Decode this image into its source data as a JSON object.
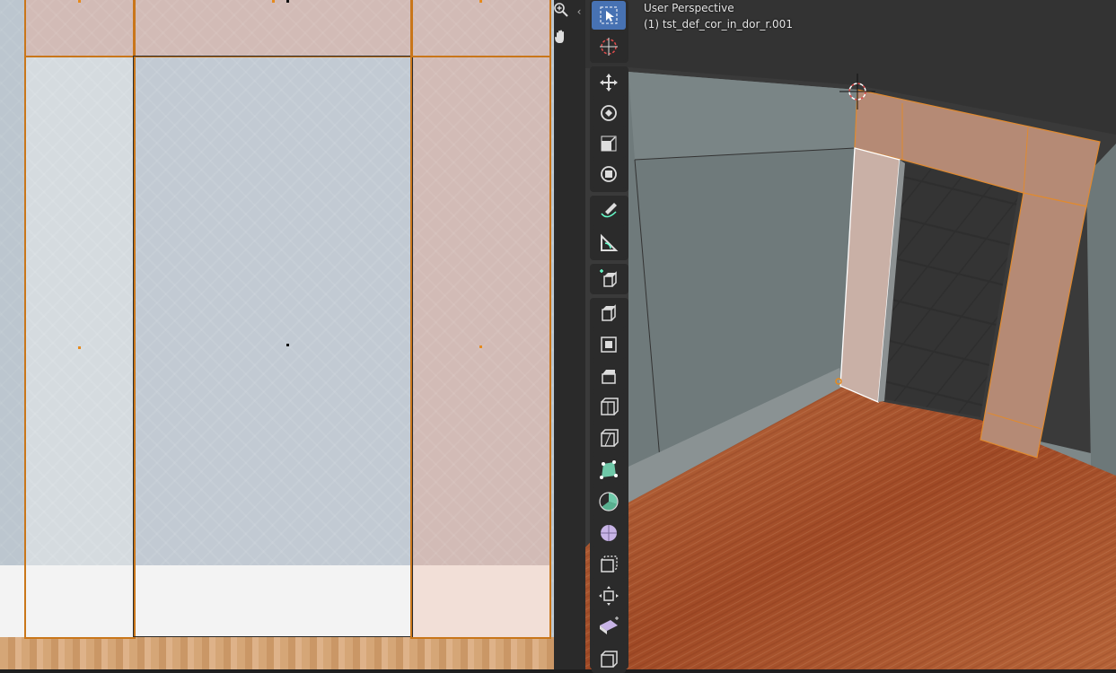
{
  "viewport": {
    "perspective_label": "User Perspective",
    "object_label": "(1) tst_def_cor_in_dor_r.001"
  },
  "colors": {
    "selection_orange": "#e58a1e",
    "active_tool_blue": "#4772b3",
    "toolbar_bg": "#2b2b2b",
    "wall_pink": "#d2bbb6",
    "wall_blue": "#c2cad3",
    "floor_wood": "#a9522b"
  },
  "icons": {
    "zoom": "magnifier-plus-icon",
    "pan": "hand-icon",
    "collapse": "chevron-left-icon"
  },
  "toolbar": {
    "tools": [
      "select-box-tool",
      "cursor-tool",
      "move-tool",
      "rotate-tool",
      "scale-tool",
      "transform-tool",
      "annotate-tool",
      "measure-tool",
      "add-cube-tool",
      "extrude-region-tool",
      "inset-faces-tool",
      "bevel-tool",
      "loop-cut-tool",
      "knife-tool",
      "poly-build-tool",
      "spin-tool",
      "smooth-tool",
      "edge-slide-tool",
      "shrink-fatten-tool",
      "shear-tool",
      "rip-region-tool"
    ]
  }
}
